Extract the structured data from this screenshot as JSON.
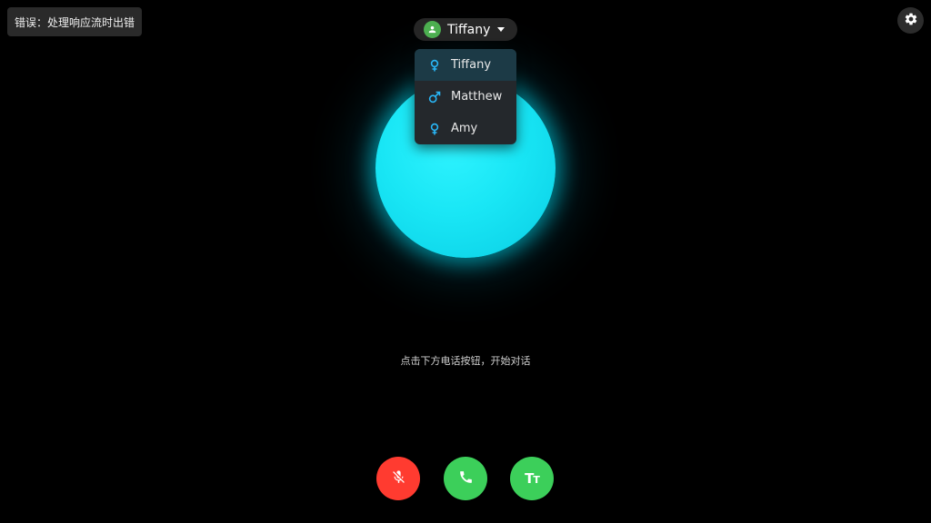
{
  "error_toast": {
    "text": "错误：处理响应流时出错"
  },
  "voice_selector": {
    "selected_voice": "Tiffany",
    "avatar_icon": "person-icon",
    "avatar_color": "#4caf50"
  },
  "dropdown": {
    "items": [
      {
        "label": "Tiffany",
        "icon": "female-icon",
        "selected": true
      },
      {
        "label": "Matthew",
        "icon": "male-icon",
        "selected": false
      },
      {
        "label": "Amy",
        "icon": "female-icon",
        "selected": false
      }
    ]
  },
  "orb": {
    "color": "#19e6f5"
  },
  "hint": {
    "text": "点击下方电话按钮，开始对话"
  },
  "controls": {
    "mic_button": {
      "icon": "mic-off-icon",
      "color": "#ff3b30"
    },
    "call_button": {
      "icon": "phone-icon",
      "color": "#3ccf5a"
    },
    "text_button": {
      "icon": "text-size-icon",
      "color": "#3ccf5a"
    }
  },
  "settings": {
    "icon": "gear-icon"
  }
}
